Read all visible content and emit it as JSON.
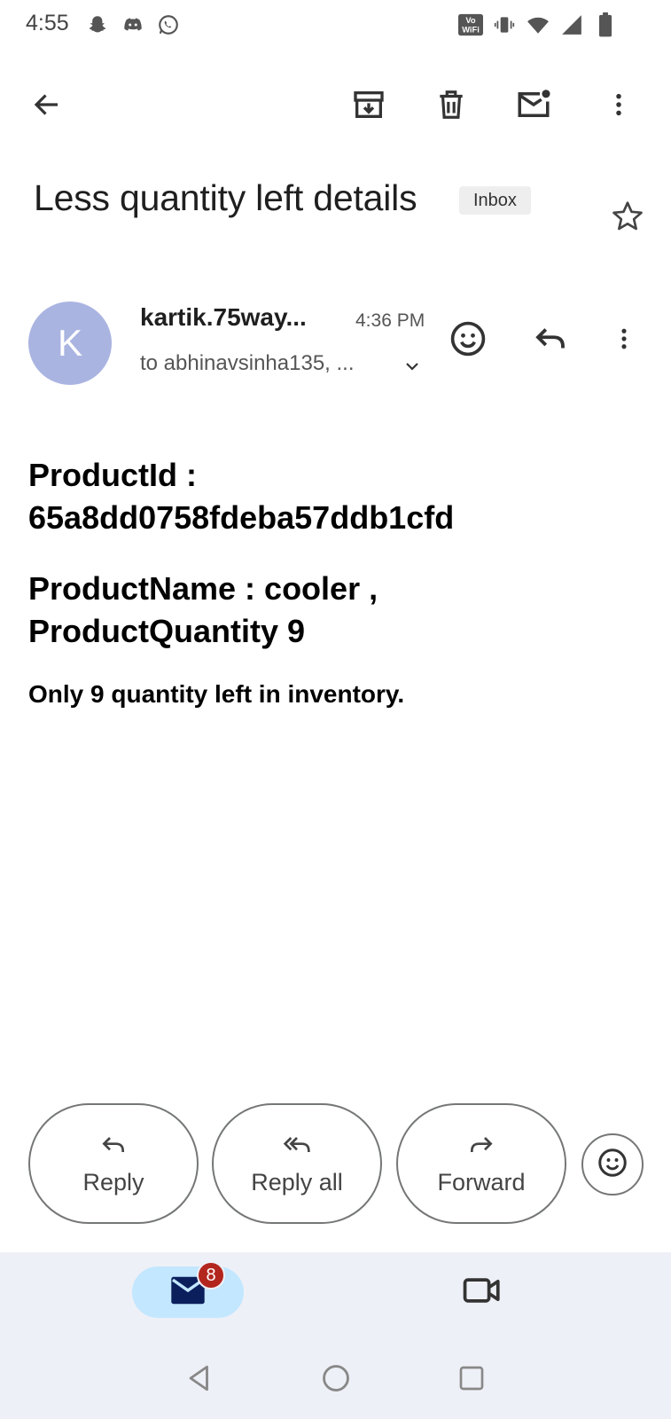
{
  "status_bar": {
    "time": "4:55",
    "left_icons": [
      "snapchat-icon",
      "discord-icon",
      "whatsapp-icon"
    ],
    "right_icons": [
      "vowifi-icon",
      "vibrate-icon",
      "wifi-icon",
      "signal-icon",
      "battery-icon"
    ]
  },
  "toolbar": {
    "icons": [
      "back-arrow-icon",
      "archive-icon",
      "delete-icon",
      "mark-unread-icon",
      "more-vert-icon"
    ]
  },
  "email": {
    "subject": "Less quantity left details",
    "label": "Inbox",
    "sender": {
      "avatar_letter": "K",
      "avatar_color": "#aab4e1",
      "name": "kartik.75way...",
      "time": "4:36 PM",
      "to": "to abhinavsinha135, ..."
    },
    "body": {
      "product_id_label": "ProductId :",
      "product_id_value": "65a8dd0758fdeba57ddb1cfd",
      "product_name_line": "ProductName : cooler ,",
      "product_quantity_line": "ProductQuantity 9",
      "note": "Only 9 quantity left in inventory."
    }
  },
  "actions": {
    "reply": "Reply",
    "reply_all": "Reply all",
    "forward": "Forward"
  },
  "bottom_nav": {
    "mail_badge": "8",
    "accent": "#c2e7ff",
    "badge_color": "#b3261e"
  }
}
